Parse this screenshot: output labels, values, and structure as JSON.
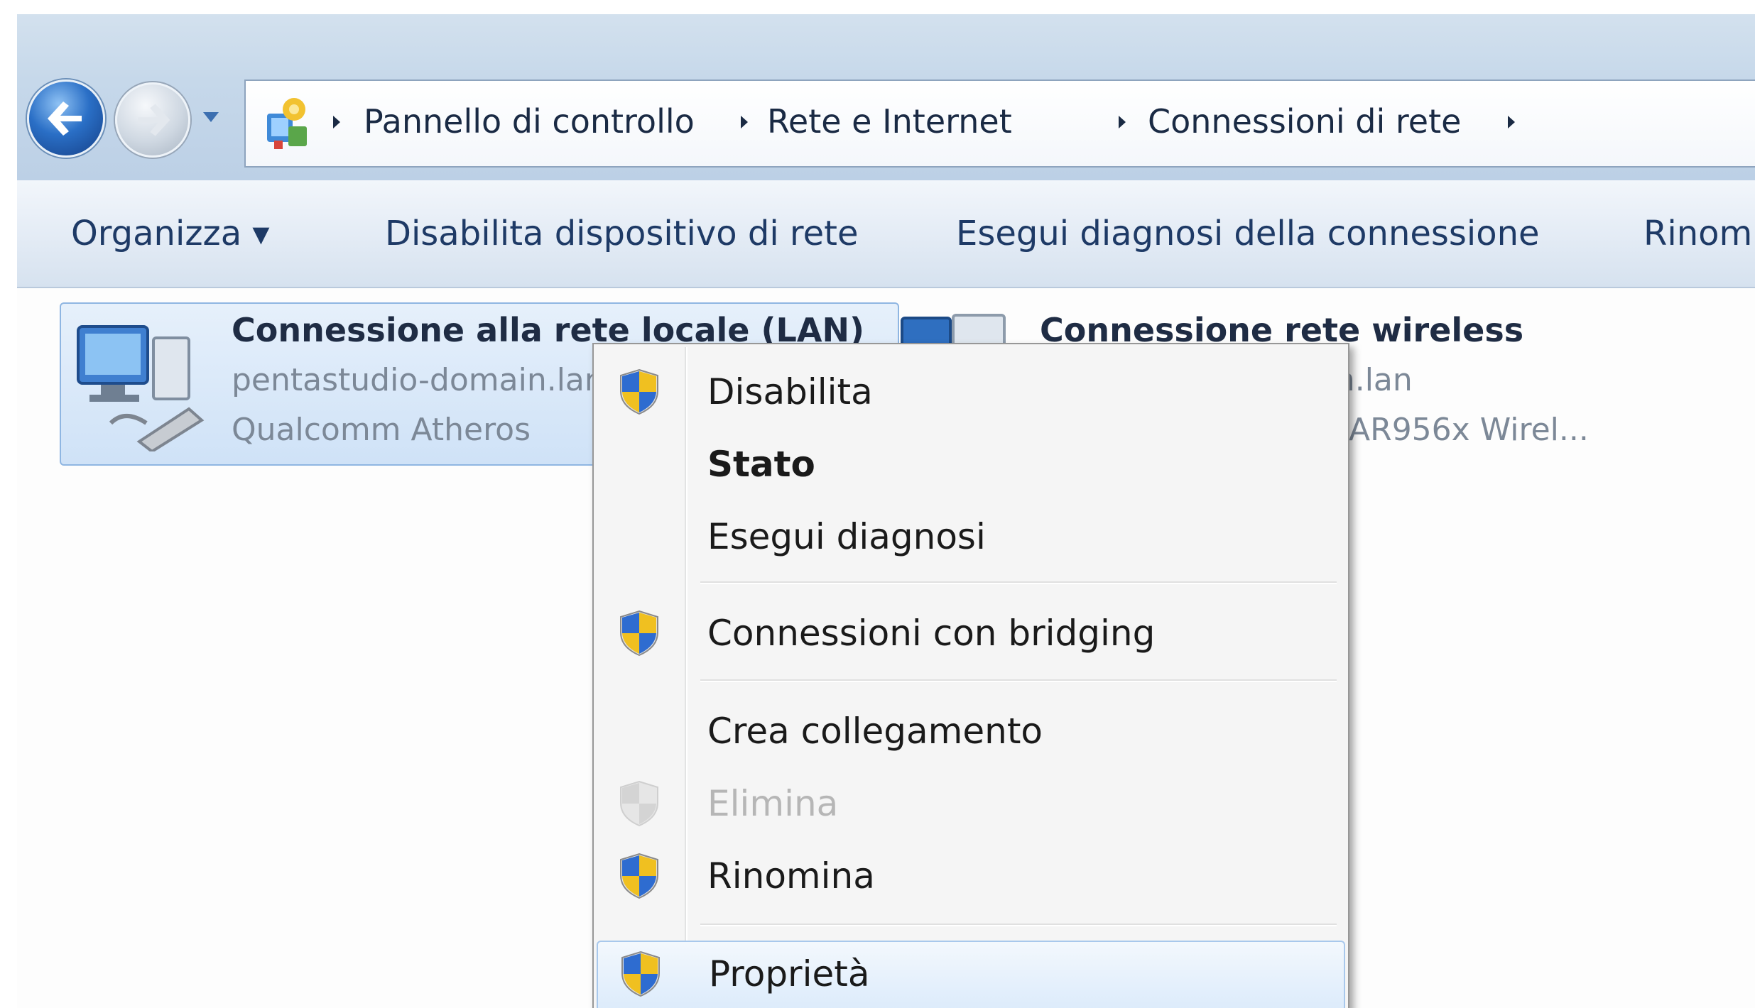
{
  "address_bar": {
    "crumbs": [
      "Pannello di controllo",
      "Rete e Internet",
      "Connessioni di rete"
    ]
  },
  "toolbar": {
    "organize_label": "Organizza ▾",
    "disable_device_label": "Disabilita dispositivo di rete",
    "diagnose_label": "Esegui diagnosi della connessione",
    "rename_label": "Rinom"
  },
  "connections": {
    "lan": {
      "name": "Connessione alla rete locale (LAN)",
      "network": "pentastudio-domain.lan",
      "adapter": "Qualcomm Atheros"
    },
    "wifi": {
      "name": "Connessione rete wireless",
      "network": "pentastudio-domain.lan",
      "adapter": "Qualcomm Atheros AR956x Wirel..."
    }
  },
  "context_menu": {
    "items": [
      {
        "label": "Disabilita",
        "icon": "shield-icon"
      },
      {
        "label": "Stato",
        "bold": true
      },
      {
        "label": "Esegui diagnosi"
      },
      {
        "label": "Connessioni con bridging",
        "icon": "shield-icon"
      },
      {
        "label": "Crea collegamento"
      },
      {
        "label": "Elimina",
        "icon": "shield-icon",
        "disabled": true
      },
      {
        "label": "Rinomina",
        "icon": "shield-icon"
      },
      {
        "label": "Proprietà",
        "icon": "shield-icon",
        "highlighted": true
      }
    ]
  },
  "colors": {
    "accent": "#2a6fc6",
    "menu_highlight": "#dcebfb",
    "disabled_text": "#b6b6b6"
  }
}
